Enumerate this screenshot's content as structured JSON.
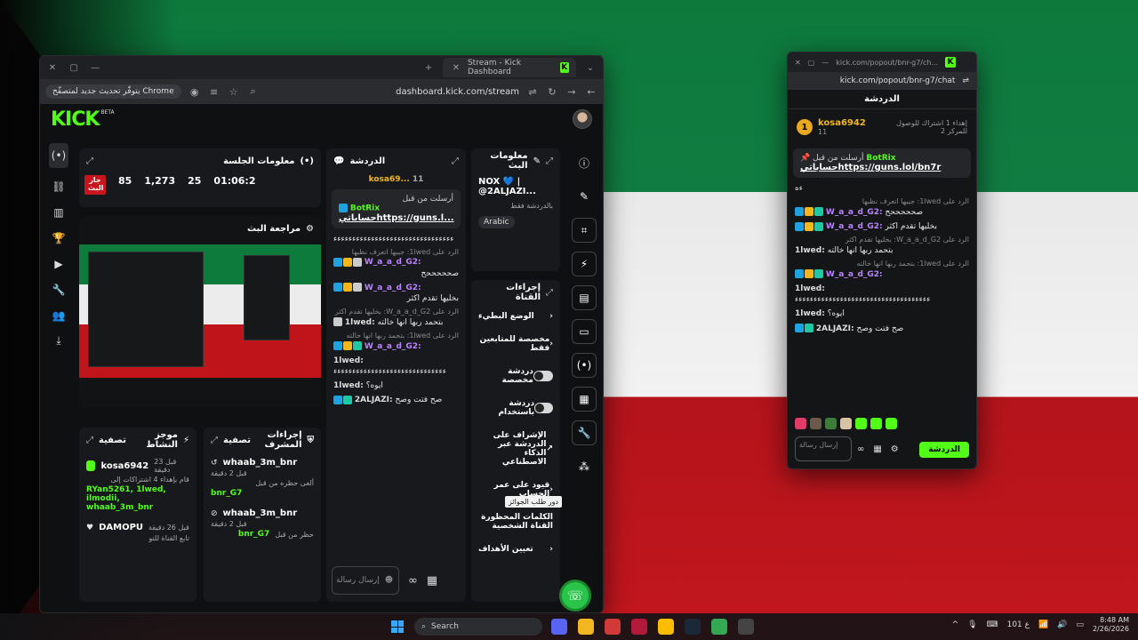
{
  "main_window": {
    "tab_title": "Stream - Kick Dashboard",
    "chrome_update": "يتوفّر تحديث جديد لمتصفّح Chrome",
    "url": "dashboard.kick.com/stream"
  },
  "brand": {
    "logo": "KICK",
    "beta": "BETA",
    "accent": "#53fc18"
  },
  "session": {
    "title": "معلومات الجلسة",
    "live_badge": "جار البث",
    "followers": "85",
    "views": "1,273",
    "viewers": "25",
    "duration": "01:06:2"
  },
  "review": {
    "title": "مراجعة البث"
  },
  "mod_panel": {
    "title": "موجز النشاط",
    "filter": "تصفية",
    "events": [
      {
        "user": "kosa6942",
        "time": "قبل 23 دقيقة",
        "text": "قام بإهداء 4 اشتراكات إلى",
        "names": "RYan5261, 1lwed, ilmodii, whaab_3m_bnr"
      },
      {
        "user": "DAMOPU",
        "time": "قبل 26 دقيقة",
        "text": "تابع القناة للتو"
      }
    ]
  },
  "actions_panel": {
    "title": "إجراءات المشرف",
    "filter": "تصفية",
    "events": [
      {
        "user": "whaab_3m_bnr",
        "time": "قبل 2 دقيقة",
        "text": "ألغى حظره من قبل",
        "by": "bnr_G7"
      },
      {
        "user": "whaab_3m_bnr",
        "time": "قبل 2 دقيقة",
        "text": "حظر من قبل",
        "by": "bnr_G7"
      }
    ]
  },
  "chat": {
    "title": "الدردشة",
    "leader": "kosa69...",
    "leader_count": "11",
    "pinned_by": "أرسلت من قبل",
    "pinned_user": "BotRix",
    "pinned_text": "حساباتي",
    "pinned_link": "https://guns.l...",
    "messages": [
      {
        "reply": "",
        "user": "",
        "text": "ءءءءءءءءءءءءءءءءءءءءءءءءءءءءءءءء"
      },
      {
        "reply": "الرد على 1lwed: جيبها اتعرف نظبها",
        "user": "W_a_a_d_G2:",
        "text": "صحححححح"
      },
      {
        "reply": "",
        "user": "W_a_a_d_G2:",
        "text": "بخليها تقدم اكثر"
      },
      {
        "reply": "الرد على W_a_a_d_G2: بخليها تقدم اكثر",
        "user": "1lwed:",
        "text": "بتحمد ربها انها خالته"
      },
      {
        "reply": "الرد على 1lwed: بتحمد ربها انها خالته",
        "user": "W_a_a_d_G2:",
        "text": ""
      },
      {
        "reply": "",
        "user": "1lwed:",
        "text": "ءءءءءءءءءءءءءءءءءءءءءءءءءءءءءء"
      },
      {
        "reply": "",
        "user": "1lwed:",
        "text": "ايوه؟"
      },
      {
        "reply": "",
        "user": "2ALJAZI:",
        "text": "صح فتت وصح"
      }
    ],
    "input_placeholder": "إرسال رسالة"
  },
  "stream_info": {
    "title": "معلومات البث",
    "stream_title": "NOX 💙 | @2ALJAZI...",
    "category_note": "بالدردشة فقط",
    "language": "Arabic"
  },
  "quick_actions": {
    "title": "إجراءات القناة",
    "items": [
      {
        "label": "الوضع البطيء",
        "kind": "arrow"
      },
      {
        "label": "مخصصة للمتابعين فقط",
        "kind": "arrow"
      },
      {
        "label": "دردشة مخصصة",
        "kind": "toggle"
      },
      {
        "label": "دردشة باستخدام",
        "kind": "toggle"
      },
      {
        "label": "الإشراف على الدردشة عبر الذكاء الاصطناعي",
        "kind": "link"
      },
      {
        "label": "قيود على عمر الحساب",
        "kind": "arrow"
      },
      {
        "label": "الكلمات المحظورة القناة الشخصية",
        "kind": "none"
      },
      {
        "label": "تعيين الأهداف",
        "kind": "arrow"
      }
    ]
  },
  "tooltip": "دور طلب الجوائز",
  "popout": {
    "url_short": "kick.com/popout/bnr-g7/ch...",
    "url": "kick.com/popout/bnr-g7/chat",
    "title": "الدردشة",
    "leader": "kosa6942",
    "leader_count": "11",
    "gift_note": "إهداء 1 اشتراك للوصول للمركز 2",
    "pinned_by": "أرسلت من قبل",
    "pinned_user": "BotRix",
    "pinned_text": "حساباتي",
    "pinned_link": "https://guns.lol/bn7r",
    "messages": [
      {
        "reply": "",
        "user": "",
        "text": "ءه"
      },
      {
        "reply": "الرد على 1lwed: جيبها اتعرف نظبها",
        "user": "W_a_a_d_G2:",
        "text": "صحححححح"
      },
      {
        "reply": "",
        "user": "W_a_a_d_G2:",
        "text": "بخليها تقدم اكثر"
      },
      {
        "reply": "الرد على W_a_a_d_G2: بخليها تقدم اكثر",
        "user": "1lwed:",
        "text": "بتحمد ربها انها خالته"
      },
      {
        "reply": "الرد على 1lwed: بتحمد ربها انها خالته",
        "user": "W_a_a_d_G2:",
        "text": ""
      },
      {
        "reply": "",
        "user": "1lwed:",
        "text": "ءءءءءءءءءءءءءءءءءءءءءءءءءءءءءءءءءءءء"
      },
      {
        "reply": "",
        "user": "1lwed:",
        "text": "ايوه؟"
      },
      {
        "reply": "",
        "user": "2ALJAZI:",
        "text": "صح فتت وصح"
      }
    ],
    "input_placeholder": "إرسال رسالة",
    "send": "الدردشة"
  },
  "taskbar": {
    "search": "Search",
    "time": "8:48 AM",
    "date": "2/26/2026",
    "lang": "ع 101"
  }
}
